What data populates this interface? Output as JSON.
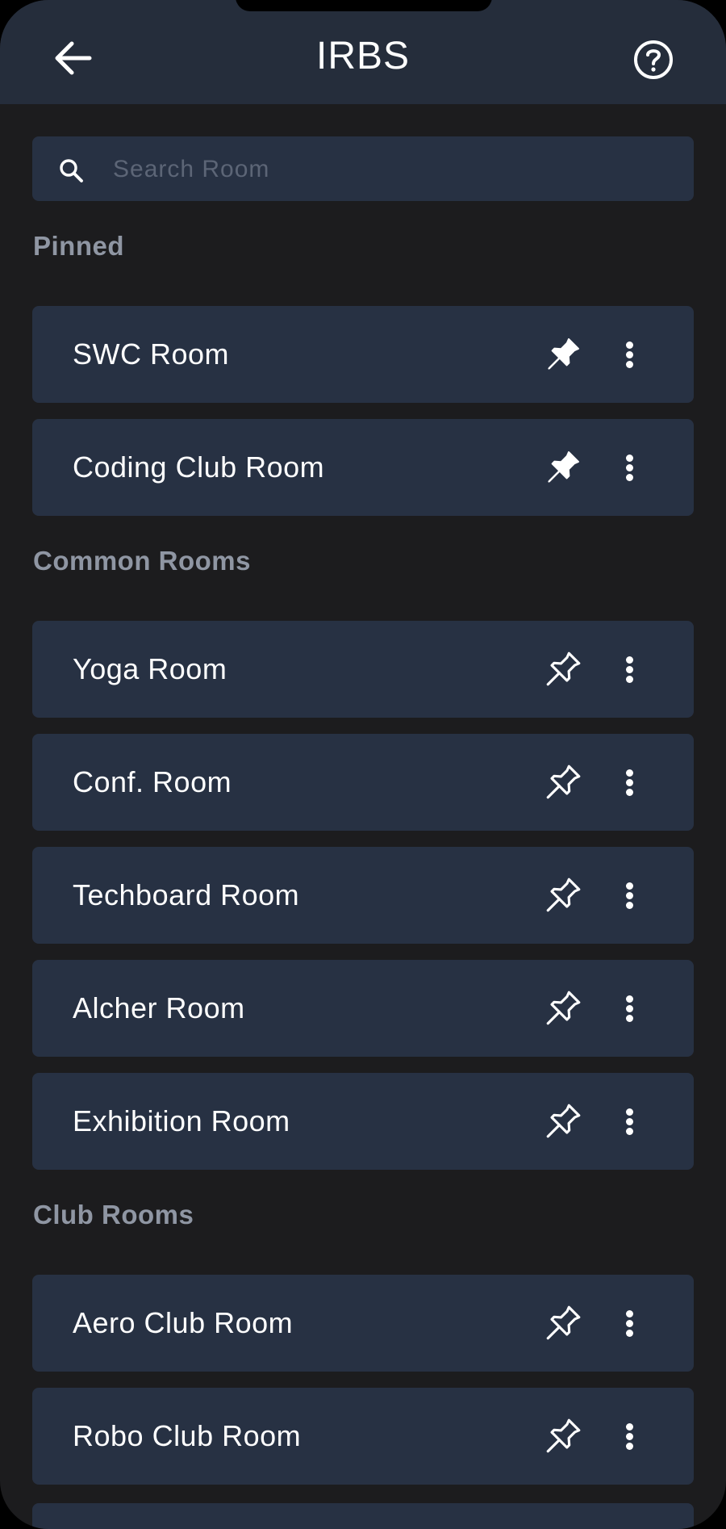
{
  "header": {
    "title": "IRBS",
    "back_icon": "arrow-left-icon",
    "help_icon": "help-circle-icon"
  },
  "search": {
    "placeholder": "Search Room",
    "value": ""
  },
  "sections": {
    "pinned": {
      "label": "Pinned",
      "rooms": [
        {
          "name": "SWC Room",
          "pinned": true
        },
        {
          "name": "Coding Club Room",
          "pinned": true
        }
      ]
    },
    "common": {
      "label": "Common Rooms",
      "rooms": [
        {
          "name": "Yoga Room",
          "pinned": false
        },
        {
          "name": "Conf. Room",
          "pinned": false
        },
        {
          "name": "Techboard Room",
          "pinned": false
        },
        {
          "name": "Alcher Room",
          "pinned": false
        },
        {
          "name": "Exhibition Room",
          "pinned": false
        }
      ]
    },
    "club": {
      "label": "Club Rooms",
      "rooms": [
        {
          "name": "Aero Club Room",
          "pinned": false
        },
        {
          "name": "Robo Club Room",
          "pinned": false
        }
      ]
    }
  },
  "colors": {
    "background": "#1c1c1e",
    "app_bar": "#252d3b",
    "card": "#273143",
    "section_heading": "#8f96a3",
    "text": "#ffffff",
    "placeholder": "#5c6576"
  }
}
